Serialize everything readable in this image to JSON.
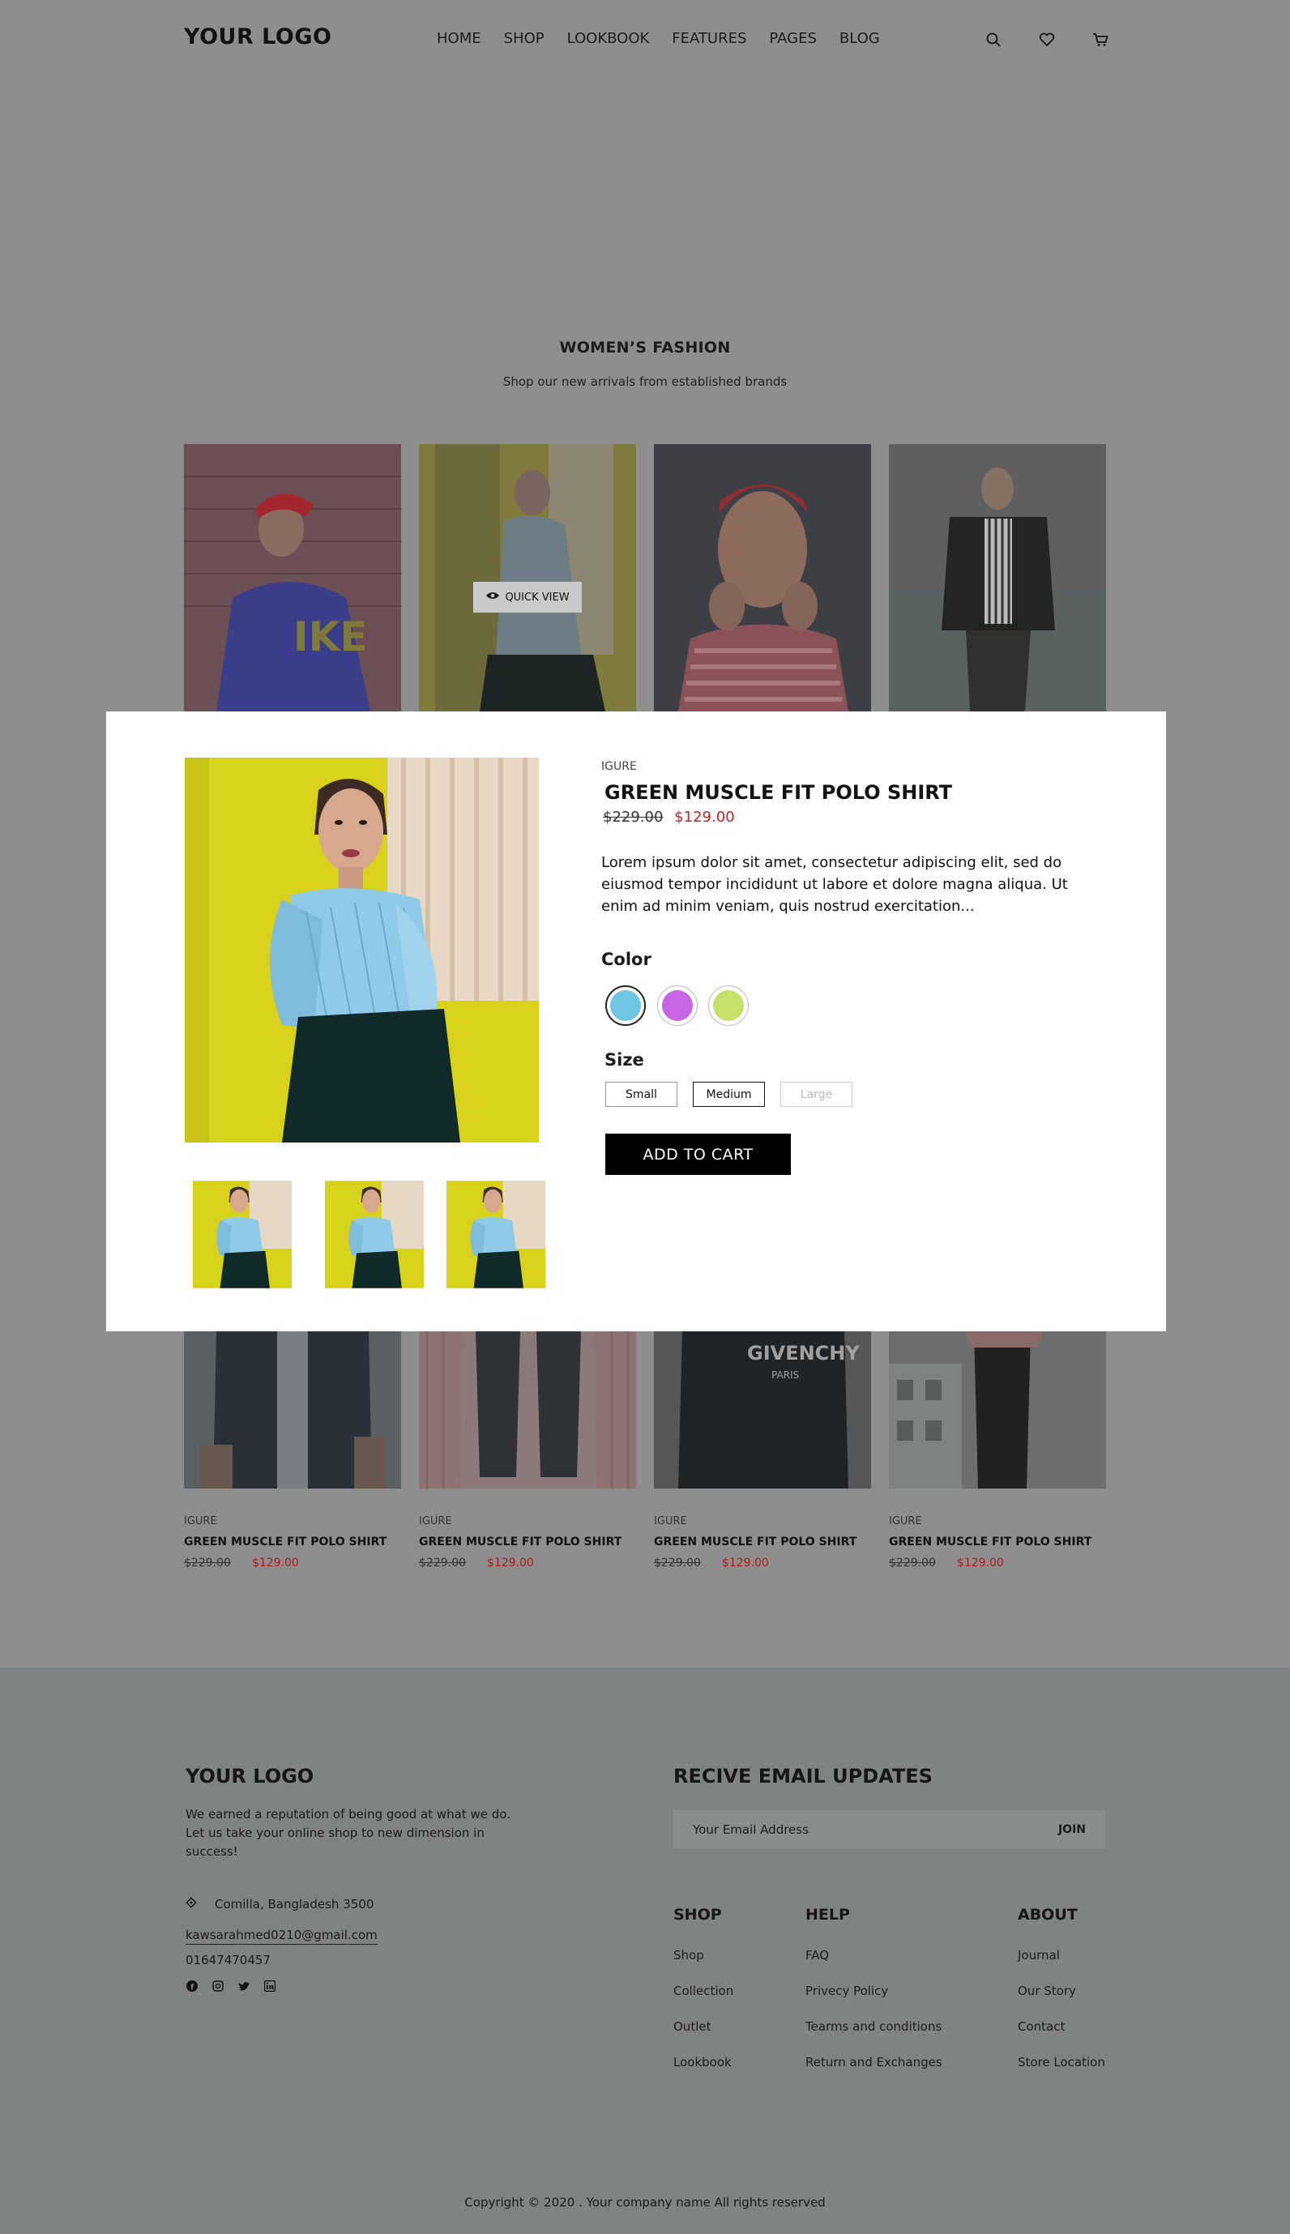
{
  "header": {
    "logo": "YOUR LOGO",
    "nav": [
      "HOME",
      "SHOP",
      "LOOKBOOK",
      "FEATURES",
      "PAGES",
      "BLOG"
    ],
    "icons": [
      "search-icon",
      "heart-icon",
      "cart-icon"
    ]
  },
  "section": {
    "title": "WOMEN’S FASHION",
    "subtitle": "Shop our new arrivals from established brands"
  },
  "quick_view": {
    "label": "QUICK VIEW",
    "icon": "eye-icon"
  },
  "products_bottom": [
    {
      "brand": "IGURE",
      "name": "GREEN MUSCLE FIT POLO SHIRT",
      "old_price": "$229.00",
      "new_price": "$129.00"
    },
    {
      "brand": "IGURE",
      "name": "GREEN MUSCLE FIT POLO SHIRT",
      "old_price": "$229.00",
      "new_price": "$129.00"
    },
    {
      "brand": "IGURE",
      "name": "GREEN MUSCLE FIT POLO SHIRT",
      "old_price": "$229.00",
      "new_price": "$129.00"
    },
    {
      "brand": "IGURE",
      "name": "GREEN MUSCLE FIT POLO SHIRT",
      "old_price": "$229.00",
      "new_price": "$129.00"
    }
  ],
  "modal": {
    "brand": "IGURE",
    "title": "GREEN MUSCLE FIT POLO SHIRT",
    "old_price": "$229.00",
    "new_price": "$129.00",
    "description": "Lorem ipsum dolor sit amet, consectetur adipiscing elit, sed do eiusmod tempor incididunt ut labore et dolore magna aliqua. Ut enim ad minim veniam, quis nostrud exercitation...",
    "color_label": "Color",
    "colors": [
      {
        "name": "blue",
        "hex": "#6ec6e2",
        "selected": true
      },
      {
        "name": "purple",
        "hex": "#c865e4",
        "selected": false
      },
      {
        "name": "green",
        "hex": "#c5e16a",
        "selected": false
      }
    ],
    "size_label": "Size",
    "sizes": [
      {
        "label": "Small",
        "state": "normal"
      },
      {
        "label": "Medium",
        "state": "selected"
      },
      {
        "label": "Large",
        "state": "disabled"
      }
    ],
    "add_to_cart": "ADD TO CART"
  },
  "footer": {
    "logo": "YOUR LOGO",
    "about": "We earned a reputation of being good at what we do. Let us take your online shop to new dimension in success!",
    "address": "Comilla, Bangladesh 3500",
    "email": "kawsarahmed0210@gmail.com",
    "phone": "01647470457",
    "social": [
      "facebook-icon",
      "instagram-icon",
      "twitter-icon",
      "linkedin-icon"
    ],
    "newsletter_title": "RECIVE EMAIL UPDATES",
    "email_placeholder": "Your Email Address",
    "join": "JOIN",
    "columns": [
      {
        "title": "SHOP",
        "links": [
          "Shop",
          "Collection",
          "Outlet",
          "Lookbook"
        ]
      },
      {
        "title": "HELP",
        "links": [
          "FAQ",
          "Privecy Policy",
          "Tearms and conditions",
          "Return and Exchanges"
        ]
      },
      {
        "title": "ABOUT",
        "links": [
          "Journal",
          "Our Story",
          "Contact",
          "Store Location"
        ]
      }
    ],
    "copyright": "Copyright © 2020 . Your company name  All rights reserved"
  }
}
